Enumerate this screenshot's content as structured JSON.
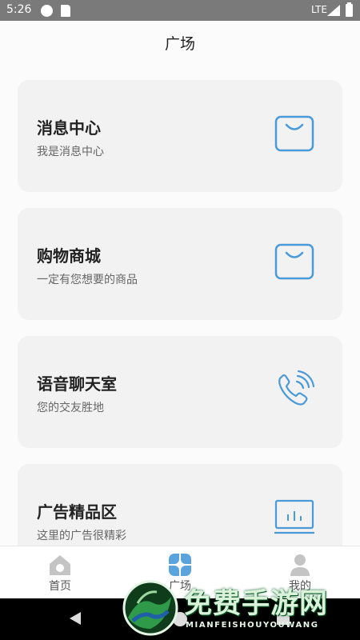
{
  "status_bar": {
    "time": "5:26",
    "network": "LTE"
  },
  "header": {
    "title": "广场"
  },
  "cards": [
    {
      "title": "消息中心",
      "subtitle": "我是消息中心",
      "icon": "shopping-bag-icon"
    },
    {
      "title": "购物商城",
      "subtitle": "一定有您想要的商品",
      "icon": "shopping-bag-icon"
    },
    {
      "title": "语音聊天室",
      "subtitle": "您的交友胜地",
      "icon": "phone-call-icon"
    },
    {
      "title": "广告精品区",
      "subtitle": "这里的广告很精彩",
      "icon": "monitor-chart-icon"
    }
  ],
  "bottom_nav": [
    {
      "label": "首页",
      "icon": "home-icon"
    },
    {
      "label": "广场",
      "icon": "clover-icon",
      "active": true
    },
    {
      "label": "我的",
      "icon": "user-icon"
    }
  ],
  "watermark": {
    "text": "免费手游网",
    "subtext": "MIANFEISHOUYOUWANG"
  },
  "colors": {
    "icon_accent": "#4a9ad8",
    "nav_active": "#5aa3dc",
    "nav_inactive": "#c4c4c4",
    "card_bg": "#f3f2f2"
  }
}
